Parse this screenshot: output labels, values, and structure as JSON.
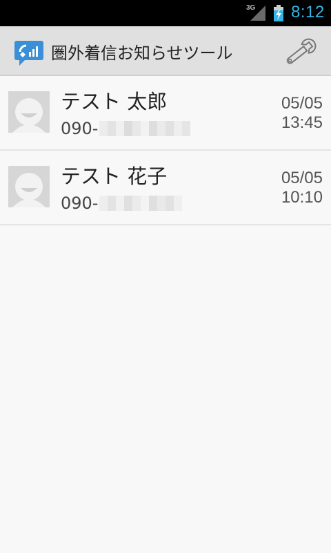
{
  "status_bar": {
    "network": "3G",
    "time": "8:12"
  },
  "action_bar": {
    "title": "圏外着信お知らせツール",
    "app_icon": "signal-phone-icon",
    "settings_icon": "wrench-icon"
  },
  "calls": [
    {
      "name": "テスト 太郎",
      "phone_prefix": "090-",
      "date": "05/05",
      "time": "13:45"
    },
    {
      "name": "テスト 花子",
      "phone_prefix": "090-",
      "date": "05/05",
      "time": "10:10"
    }
  ],
  "colors": {
    "accent": "#33b5e5",
    "action_bar": "#e0e0e0",
    "background": "#f8f8f8"
  }
}
